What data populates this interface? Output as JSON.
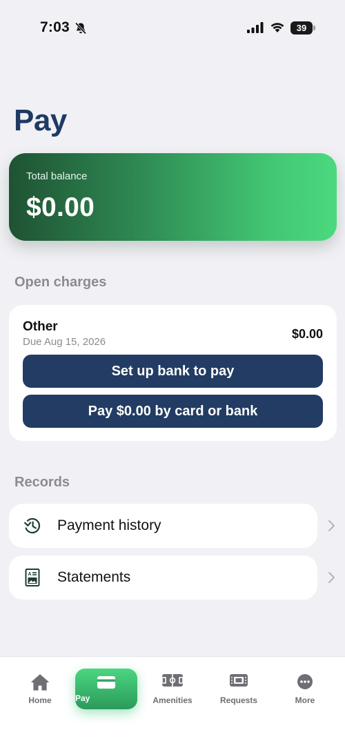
{
  "status_bar": {
    "time": "7:03",
    "battery": "39"
  },
  "page": {
    "title": "Pay"
  },
  "balance": {
    "label": "Total balance",
    "value": "$0.00"
  },
  "open_charges": {
    "heading": "Open charges",
    "items": [
      {
        "name": "Other",
        "due": "Due Aug 15, 2026",
        "amount": "$0.00"
      }
    ],
    "setup_button": "Set up bank to pay",
    "pay_button": "Pay $0.00 by card or bank"
  },
  "records": {
    "heading": "Records",
    "items": [
      {
        "label": "Payment history",
        "icon": "history-icon"
      },
      {
        "label": "Statements",
        "icon": "statement-icon"
      }
    ]
  },
  "tab_bar": {
    "active": "Pay",
    "tabs": [
      {
        "label": "Home",
        "icon": "home-icon"
      },
      {
        "label": "Pay",
        "icon": "card-icon"
      },
      {
        "label": "Amenities",
        "icon": "amenities-icon"
      },
      {
        "label": "Requests",
        "icon": "requests-icon"
      },
      {
        "label": "More",
        "icon": "more-icon"
      }
    ]
  },
  "colors": {
    "primary_navy": "#223c63",
    "title_navy": "#1e3a64",
    "accent_green": "#4bd681",
    "background": "#f1f1f5"
  }
}
